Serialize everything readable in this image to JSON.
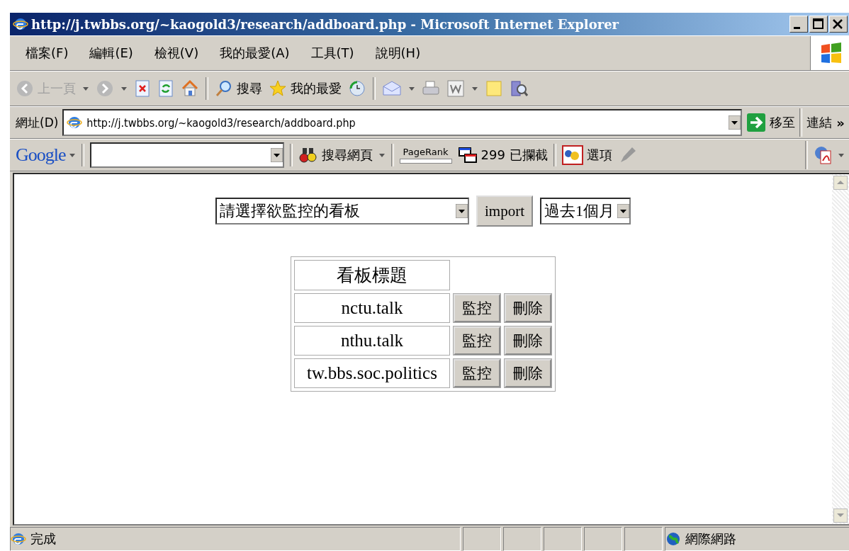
{
  "window": {
    "title": "http://j.twbbs.org/~kaogold3/research/addboard.php - Microsoft Internet Explorer"
  },
  "menu_bar": [
    "檔案(F)",
    "編輯(E)",
    "檢視(V)",
    "我的最愛(A)",
    "工具(T)",
    "說明(H)"
  ],
  "toolbar": {
    "back": "上一頁",
    "search": "搜尋",
    "favorites": "我的最愛"
  },
  "address_bar": {
    "label": "網址(D)",
    "value": "http://j.twbbs.org/~kaogold3/research/addboard.php",
    "go": "移至",
    "links": "連結",
    "more": "»"
  },
  "google_toolbar": {
    "logo": "Google",
    "search_web": "搜尋網頁",
    "pagerank": "PageRank",
    "blocked": "299 已攔截",
    "options": "選項"
  },
  "form": {
    "board_select": "請選擇欲監控的看板",
    "import_button": "import",
    "period_select": "過去1個月"
  },
  "table": {
    "header": "看板標題",
    "rows": [
      {
        "name": "nctu.talk",
        "monitor": "監控",
        "delete": "刪除"
      },
      {
        "name": "nthu.talk",
        "monitor": "監控",
        "delete": "刪除"
      },
      {
        "name": "tw.bbs.soc.politics",
        "monitor": "監控",
        "delete": "刪除"
      }
    ]
  },
  "status_bar": {
    "text": "完成",
    "zone": "網際網路"
  }
}
